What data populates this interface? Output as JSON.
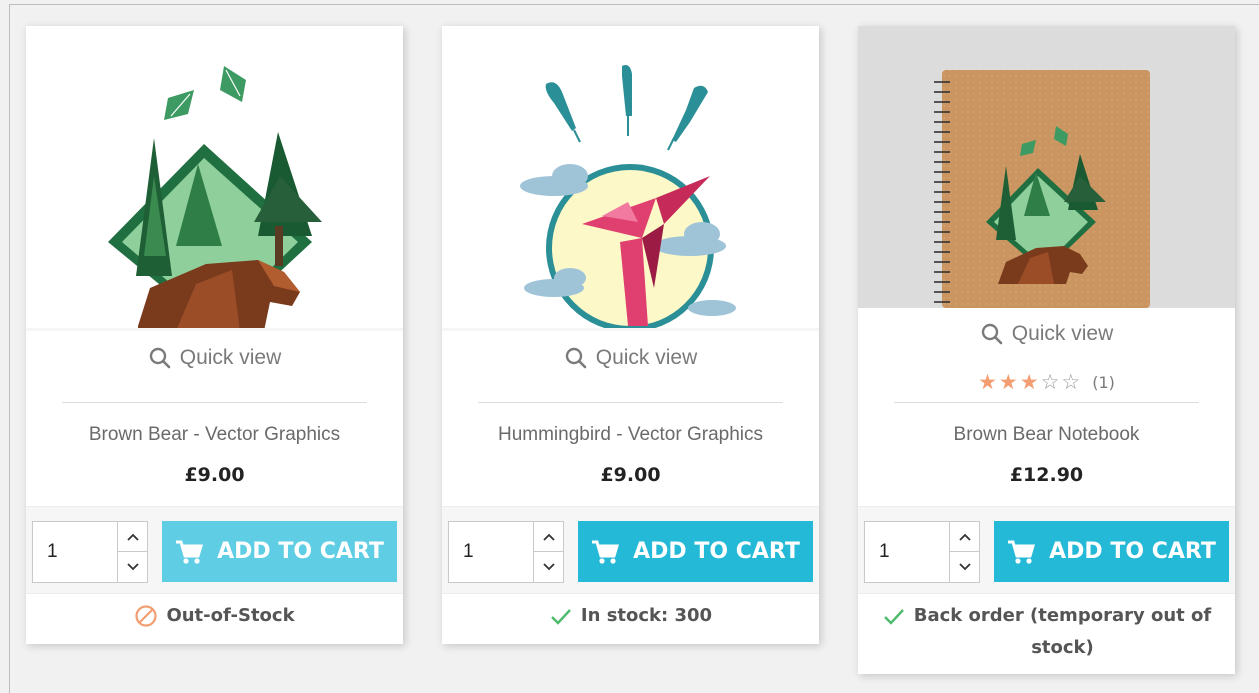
{
  "products": [
    {
      "quick_view": "Quick view",
      "name": "Brown Bear - Vector Graphics",
      "price": "£9.00",
      "qty": "1",
      "add_label": "ADD TO CART",
      "stock": "Out-of-Stock",
      "stock_status": "out"
    },
    {
      "quick_view": "Quick view",
      "name": "Hummingbird - Vector Graphics",
      "price": "£9.00",
      "qty": "1",
      "add_label": "ADD TO CART",
      "stock": "In stock: 300",
      "stock_status": "in"
    },
    {
      "quick_view": "Quick view",
      "name": "Brown Bear Notebook",
      "price": "£12.90",
      "qty": "1",
      "add_label": "ADD TO CART",
      "stock_line1": "Back order (temporary out of",
      "stock_line2": "stock)",
      "stock_status": "backorder",
      "rating": 3,
      "rating_max": 5,
      "rating_count": "(1)"
    }
  ],
  "colors": {
    "accent": "#24b9d7",
    "accent_disabled": "#5fcee4",
    "star": "#f39d72",
    "check": "#4cbb6c",
    "out_of_stock": "#f39d72"
  },
  "icons": {
    "quick_view": "search-icon",
    "cart": "shopping-cart-icon",
    "in_stock": "check-icon",
    "out_of_stock": "ban-icon",
    "qty_up": "chevron-up-icon",
    "qty_down": "chevron-down-icon"
  }
}
